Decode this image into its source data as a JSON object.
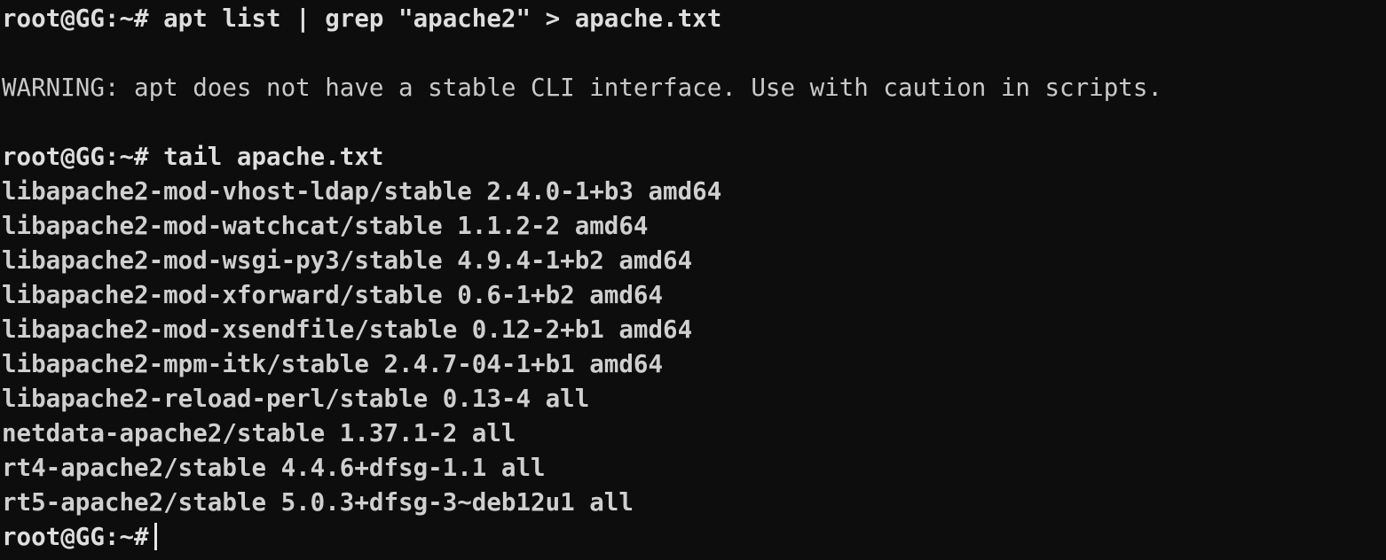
{
  "terminal": {
    "background_color": "#0d0d0d",
    "foreground_color": "#d6d6d6",
    "cursor_color": "#e8e8e8",
    "prompt": "root@GG:~#",
    "lines": [
      {
        "kind": "cmd",
        "text": "root@GG:~# apt list | grep \"apache2\" > apache.txt"
      },
      {
        "kind": "blank",
        "text": " "
      },
      {
        "kind": "warn",
        "text": "WARNING: apt does not have a stable CLI interface. Use with caution in scripts."
      },
      {
        "kind": "blank",
        "text": " "
      },
      {
        "kind": "cmd",
        "text": "root@GG:~# tail apache.txt"
      },
      {
        "kind": "out",
        "text": "libapache2-mod-vhost-ldap/stable 2.4.0-1+b3 amd64"
      },
      {
        "kind": "out",
        "text": "libapache2-mod-watchcat/stable 1.1.2-2 amd64"
      },
      {
        "kind": "out",
        "text": "libapache2-mod-wsgi-py3/stable 4.9.4-1+b2 amd64"
      },
      {
        "kind": "out",
        "text": "libapache2-mod-xforward/stable 0.6-1+b2 amd64"
      },
      {
        "kind": "out",
        "text": "libapache2-mod-xsendfile/stable 0.12-2+b1 amd64"
      },
      {
        "kind": "out",
        "text": "libapache2-mpm-itk/stable 2.4.7-04-1+b1 amd64"
      },
      {
        "kind": "out",
        "text": "libapache2-reload-perl/stable 0.13-4 all"
      },
      {
        "kind": "out",
        "text": "netdata-apache2/stable 1.37.1-2 all"
      },
      {
        "kind": "out",
        "text": "rt4-apache2/stable 4.4.6+dfsg-1.1 all"
      },
      {
        "kind": "out",
        "text": "rt5-apache2/stable 5.0.3+dfsg-3~deb12u1 all"
      }
    ],
    "final_prompt": "root@GG:~#"
  }
}
